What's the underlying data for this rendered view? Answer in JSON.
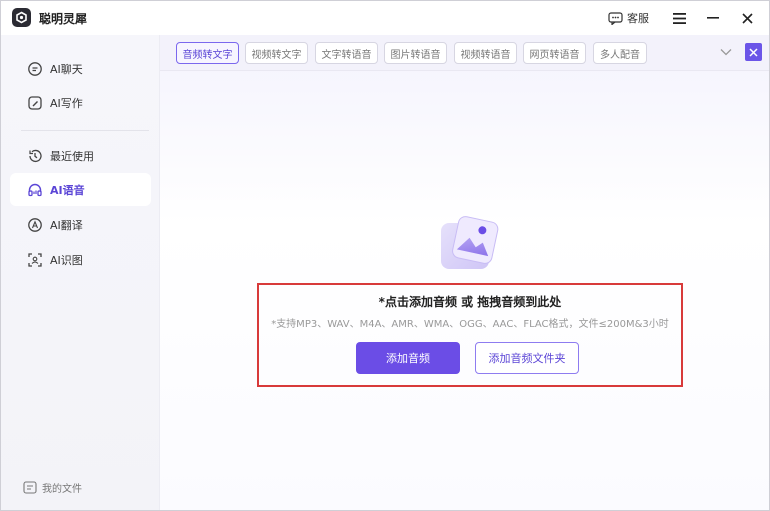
{
  "app": {
    "title": "聪明灵犀"
  },
  "titlebar": {
    "service_label": "客服"
  },
  "sidebar": {
    "items": [
      {
        "label": "AI聊天",
        "icon": "chat-icon"
      },
      {
        "label": "AI写作",
        "icon": "pen-icon"
      },
      {
        "label": "最近使用",
        "icon": "history-icon"
      },
      {
        "label": "AI语音",
        "icon": "headphones-icon",
        "active": true
      },
      {
        "label": "AI翻译",
        "icon": "translate-icon"
      },
      {
        "label": "AI识图",
        "icon": "scan-icon"
      }
    ],
    "footer_label": "我的文件"
  },
  "tabs": [
    {
      "label": "音频转文字",
      "active": true
    },
    {
      "label": "视频转文字"
    },
    {
      "label": "文字转语音"
    },
    {
      "label": "图片转语音"
    },
    {
      "label": "视频转语音"
    },
    {
      "label": "网页转语音"
    },
    {
      "label": "多人配音"
    }
  ],
  "upload": {
    "title": "*点击添加音频 或 拖拽音频到此处",
    "hint": "*支持MP3、WAV、M4A、AMR、WMA、OGG、AAC、FLAC格式，文件≤200M&3小时",
    "add_button": "添加音频",
    "add_folder_button": "添加音频文件夹"
  },
  "colors": {
    "accent": "#6b4de6",
    "highlight_box": "#d83a3a"
  }
}
